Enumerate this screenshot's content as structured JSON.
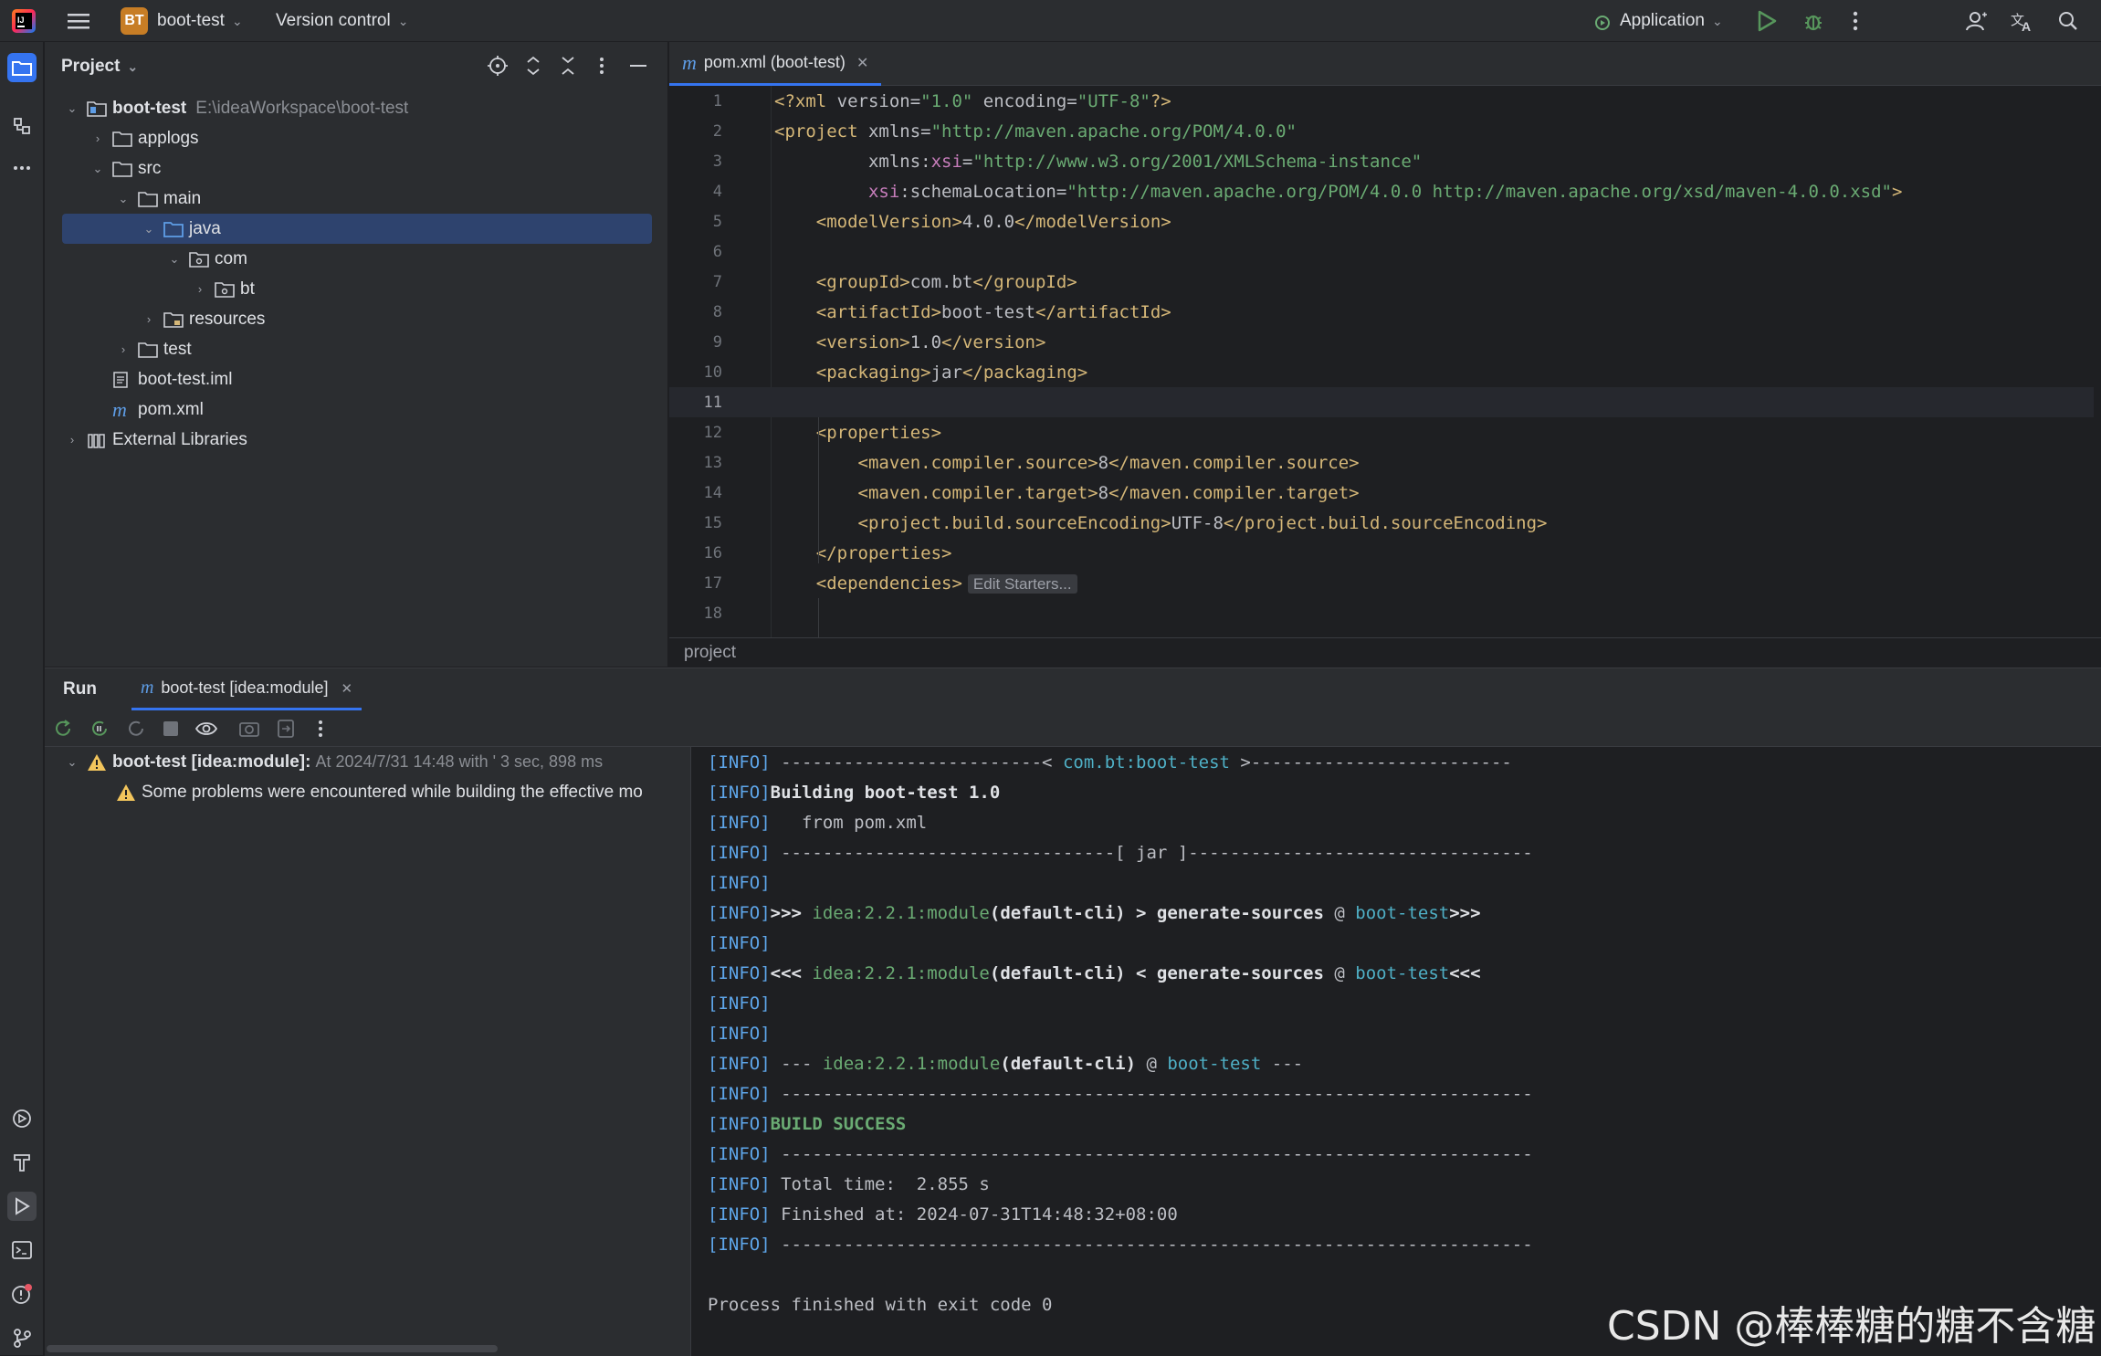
{
  "titlebar": {
    "project_badge": "BT",
    "project_name": "boot-test",
    "vcs_label": "Version control",
    "run_config": "Application"
  },
  "project_panel": {
    "title": "Project",
    "tree": [
      {
        "label": "boot-test",
        "path": "E:\\ideaWorkspace\\boot-test"
      },
      {
        "label": "applogs"
      },
      {
        "label": "src"
      },
      {
        "label": "main"
      },
      {
        "label": "java"
      },
      {
        "label": "com"
      },
      {
        "label": "bt"
      },
      {
        "label": "resources"
      },
      {
        "label": "test"
      },
      {
        "label": "boot-test.iml"
      },
      {
        "label": "pom.xml"
      },
      {
        "label": "External Libraries"
      }
    ]
  },
  "editor": {
    "tab_label": "pom.xml (boot-test)",
    "line_numbers": [
      "1",
      "2",
      "3",
      "4",
      "5",
      "6",
      "7",
      "8",
      "9",
      "10",
      "11",
      "12",
      "13",
      "14",
      "15",
      "16",
      "17",
      "18"
    ],
    "lines": [
      "<?xml version=\"1.0\" encoding=\"UTF-8\"?>",
      "<project xmlns=\"http://maven.apache.org/POM/4.0.0\"",
      "         xmlns:xsi=\"http://www.w3.org/2001/XMLSchema-instance\"",
      "         xsi:schemaLocation=\"http://maven.apache.org/POM/4.0.0 http://maven.apache.org/xsd/maven-4.0.0.xsd\">",
      "    <modelVersion>4.0.0</modelVersion>",
      "",
      "    <groupId>com.bt</groupId>",
      "    <artifactId>boot-test</artifactId>",
      "    <version>1.0</version>",
      "    <packaging>jar</packaging>",
      "",
      "    <properties>",
      "        <maven.compiler.source>8</maven.compiler.source>",
      "        <maven.compiler.target>8</maven.compiler.target>",
      "        <project.build.sourceEncoding>UTF-8</project.build.sourceEncoding>",
      "    </properties>",
      "    <dependencies>",
      ""
    ],
    "inlay_hint": "Edit Starters...",
    "breadcrumb": "project"
  },
  "run_panel": {
    "title": "Run",
    "tab_label": "boot-test [idea:module]",
    "tree_root_label": "boot-test [idea:module]:",
    "tree_root_meta": "At 2024/7/31 14:48 with ' 3 sec, 898 ms",
    "tree_child_label": "Some problems were encountered while building the effective mo",
    "console": [
      "[INFO] -------------------------< com.bt:boot-test >-------------------------",
      "[INFO] Building boot-test 1.0",
      "[INFO]   from pom.xml",
      "[INFO] --------------------------------[ jar ]---------------------------------",
      "[INFO]",
      "[INFO] >>> idea:2.2.1:module (default-cli) > generate-sources @ boot-test >>>",
      "[INFO]",
      "[INFO] <<< idea:2.2.1:module (default-cli) < generate-sources @ boot-test <<<",
      "[INFO]",
      "[INFO]",
      "[INFO] --- idea:2.2.1:module (default-cli) @ boot-test ---",
      "[INFO] ------------------------------------------------------------------------",
      "[INFO] BUILD SUCCESS",
      "[INFO] ------------------------------------------------------------------------",
      "[INFO] Total time:  2.855 s",
      "[INFO] Finished at: 2024-07-31T14:48:32+08:00",
      "[INFO] ------------------------------------------------------------------------",
      "",
      "Process finished with exit code 0"
    ]
  },
  "watermark": "CSDN @棒棒糖的糖不含糖",
  "colors": {
    "accent": "#3574f0",
    "selection": "#2e436e",
    "tag": "#d5b778",
    "string": "#6aab73",
    "info": "#5ea6ea"
  }
}
